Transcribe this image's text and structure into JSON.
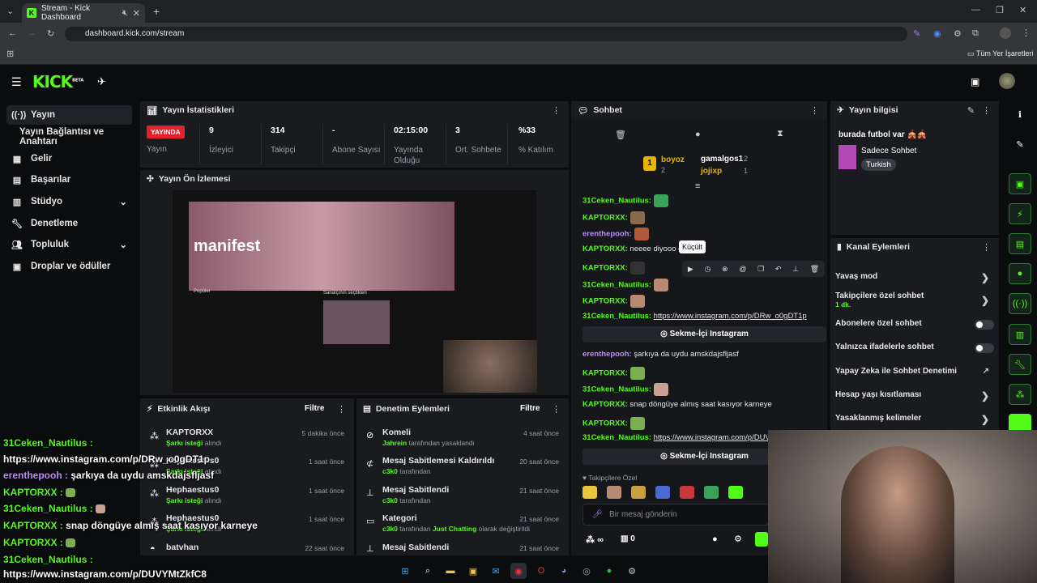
{
  "browser": {
    "tab_title": "Stream - Kick Dashboard",
    "url": "dashboard.kick.com/stream",
    "bookmarks_label": "Tüm Yer İşaretleri"
  },
  "header": {
    "logo": "KICK",
    "beta": "BETA"
  },
  "sidebar": {
    "items": [
      {
        "label": "Yayın",
        "icon": "broadcast-icon"
      },
      {
        "label": "Yayın Bağlantısı ve Anahtarı"
      },
      {
        "label": "Gelir",
        "icon": "revenue-icon"
      },
      {
        "label": "Başarılar",
        "icon": "trophy-icon"
      },
      {
        "label": "Stüdyo",
        "icon": "studio-icon"
      },
      {
        "label": "Denetleme",
        "icon": "wrench-icon"
      },
      {
        "label": "Topluluk",
        "icon": "community-icon"
      },
      {
        "label": "Droplar ve ödüller",
        "icon": "gift-icon"
      }
    ]
  },
  "stats": {
    "title": "Yayın İstatistikleri",
    "live_badge": "YAYINDA",
    "items": [
      {
        "value": "",
        "label": "Yayın"
      },
      {
        "value": "9",
        "label": "İzleyici"
      },
      {
        "value": "314",
        "label": "Takipçi"
      },
      {
        "value": "-",
        "label": "Abone Sayısı"
      },
      {
        "value": "02:15:00",
        "label": "Yayında Olduğu"
      },
      {
        "value": "3",
        "label": "Ort. Sohbete"
      },
      {
        "value": "%33",
        "label": "% Katılım"
      }
    ]
  },
  "preview": {
    "title": "Yayın Ön İzlemesi",
    "album": "manifest",
    "popular": "Popüler",
    "picks": "Sanatçının seçtikleri"
  },
  "activity": {
    "title": "Etkinlik Akışı",
    "filter": "Filtre",
    "items": [
      {
        "user": "KAPTORXX",
        "action": "Şarkı isteği",
        "suffix": "alındı",
        "time": "5 dakika önce"
      },
      {
        "user": "Hephaestus0",
        "action": "Şarkı isteği",
        "suffix": "alındı",
        "time": "1 saat önce"
      },
      {
        "user": "Hephaestus0",
        "action": "Şarkı isteği",
        "suffix": "alındı",
        "time": "1 saat önce"
      },
      {
        "user": "Hephaestus0",
        "action": "Şarkı isteği",
        "suffix": "alındı",
        "time": "1 saat önce"
      },
      {
        "user": "batvhan",
        "action": "",
        "suffix": "",
        "time": "22 saat önce"
      }
    ]
  },
  "moderation": {
    "title": "Denetim Eylemleri",
    "filter": "Filtre",
    "items": [
      {
        "title": "Komeli",
        "by": "Jahrein",
        "text": "tarafından yasaklandı",
        "time": "4 saat önce"
      },
      {
        "title": "Mesaj Sabitlemesi Kaldırıldı",
        "by": "c3k0",
        "text": "tarafından",
        "time": "20 saat önce"
      },
      {
        "title": "Mesaj Sabitlendi",
        "by": "c3k0",
        "text": "tarafından",
        "time": "21 saat önce"
      },
      {
        "title": "Kategori",
        "by": "c3k0",
        "text": "tarafından",
        "extra": "Just Chatting",
        "extra2": "olarak değiştirildi",
        "time": "21 saat önce"
      },
      {
        "title": "Mesaj Sabitlendi",
        "by": "",
        "text": "",
        "time": "21 saat önce"
      }
    ]
  },
  "chat": {
    "title": "Sohbet",
    "leaders": [
      {
        "name": "boyoz",
        "count": "2"
      },
      {
        "name": "gamalgos1",
        "count": "2"
      },
      {
        "name": "jojixp",
        "count": "1"
      }
    ],
    "rank_badge": "1",
    "tooltip": "Küçült",
    "messages": [
      {
        "user": "31Ceken_Nautilus:",
        "text": ""
      },
      {
        "user": "KAPTORXX:",
        "text": ""
      },
      {
        "user": "erenthepooh:",
        "text": ""
      },
      {
        "user": "KAPTORXX:",
        "text": "neeee diyooo o"
      },
      {
        "user": "KAPTORXX:",
        "text": ""
      },
      {
        "user": "31Ceken_Nautilus:",
        "text": ""
      },
      {
        "user": "KAPTORXX:",
        "text": ""
      },
      {
        "user": "31Ceken_Nautilus:",
        "text": "https://www.instagram.com/p/DRw_o0gDT1p"
      },
      {
        "user": "erenthepooh:",
        "text": "şarkıya da uydu amskdajsfljasf"
      },
      {
        "user": "KAPTORXX:",
        "text": ""
      },
      {
        "user": "31Ceken_Nautilus:",
        "text": ""
      },
      {
        "user": "KAPTORXX:",
        "text": "snap döngüye almış saat kasıyor karneye"
      },
      {
        "user": "KAPTORXX:",
        "text": ""
      },
      {
        "user": "31Ceken_Nautilus:",
        "text": "https://www.instagram.com/p/DUVY"
      }
    ],
    "embed_label": "Sekme-İçi Instagram",
    "followers_only": "Takipçilere Özel",
    "input_placeholder": "Bir mesaj gönderin",
    "infinity": "∞",
    "gift_count": "0"
  },
  "stream_info": {
    "title": "Yayın bilgisi",
    "stream_title": "burada futbol var 🎪🎪",
    "category": "Sadece Sohbet",
    "language": "Turkish"
  },
  "channel_actions": {
    "title": "Kanal Eylemleri",
    "items": [
      {
        "label": "Yavaş mod",
        "control": "chevron"
      },
      {
        "label": "Takipçilere özel sohbet",
        "sub": "1 dk.",
        "control": "chevron"
      },
      {
        "label": "Abonelere özel sohbet",
        "control": "toggle"
      },
      {
        "label": "Yalnızca ifadelerle sohbet",
        "control": "toggle"
      },
      {
        "label": "Yapay Zeka ile Sohbet Denetimi",
        "control": "external"
      },
      {
        "label": "Hesap yaşı kısıtlaması",
        "control": "chevron"
      },
      {
        "label": "Yasaklanmış kelimeler",
        "control": "chevron"
      }
    ]
  },
  "overlay_chat": [
    {
      "user": "31Ceken_Nautilus :",
      "text": ""
    },
    {
      "user": "",
      "text": "https://www.instagram.com/p/DRw_o0gDT1p"
    },
    {
      "user": "erenthepooh :",
      "text": "şarkıya da uydu amskdajsfljasf"
    },
    {
      "user": "KAPTORXX :",
      "text": ""
    },
    {
      "user": "31Ceken_Nautilus :",
      "text": ""
    },
    {
      "user": "KAPTORXX :",
      "text": "snap döngüye almış saat kasıyor karneye"
    },
    {
      "user": "KAPTORXX :",
      "text": ""
    },
    {
      "user": "31Ceken_Nautilus :",
      "text": ""
    },
    {
      "user": "",
      "text": "https://www.instagram.com/p/DUVYMtZkfC8"
    }
  ],
  "colors": {
    "accent": "#53fc18",
    "panel": "#191b1f",
    "bg": "#0b0c0e",
    "live": "#e3212b"
  }
}
